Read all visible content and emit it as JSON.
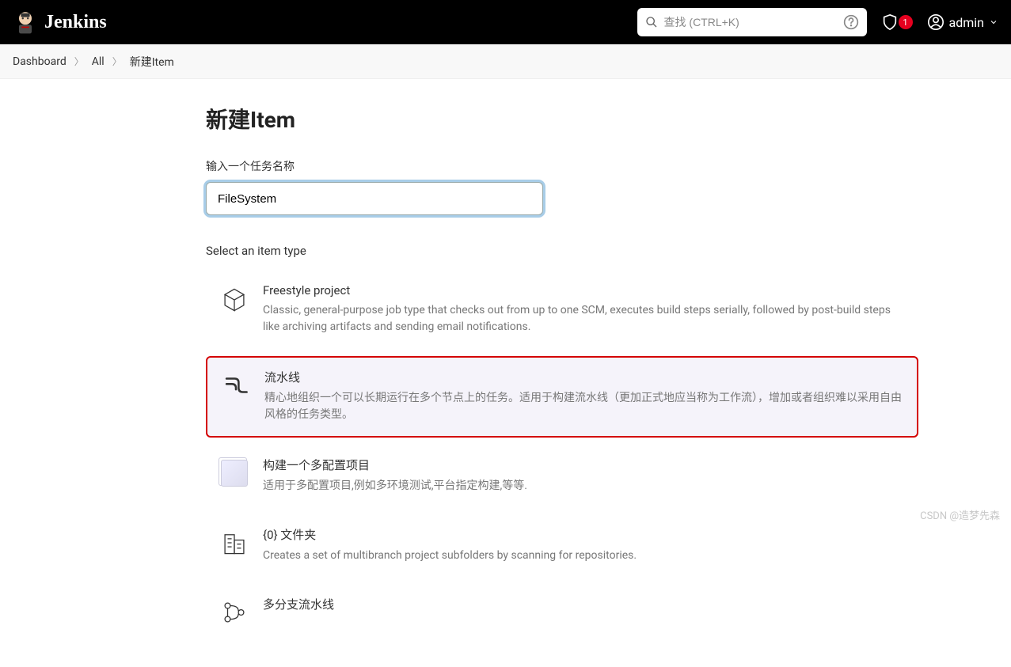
{
  "header": {
    "logo_text": "Jenkins",
    "search_placeholder": "查找 (CTRL+K)",
    "alert_count": "1",
    "user_name": "admin"
  },
  "breadcrumb": {
    "items": [
      "Dashboard",
      "All",
      "新建Item"
    ]
  },
  "page": {
    "title": "新建Item",
    "name_label": "输入一个任务名称",
    "name_value": "FileSystem",
    "select_label": "Select an item type"
  },
  "items": [
    {
      "title": "Freestyle project",
      "desc": "Classic, general-purpose job type that checks out from up to one SCM, executes build steps serially, followed by post-build steps like archiving artifacts and sending email notifications."
    },
    {
      "title": "流水线",
      "desc": "精心地组织一个可以长期运行在多个节点上的任务。适用于构建流水线（更加正式地应当称为工作流），增加或者组织难以采用自由风格的任务类型。"
    },
    {
      "title": "构建一个多配置项目",
      "desc": "适用于多配置项目,例如多环境测试,平台指定构建,等等."
    },
    {
      "title": "{0} 文件夹",
      "desc": "Creates a set of multibranch project subfolders by scanning for repositories."
    },
    {
      "title": "多分支流水线",
      "desc": ""
    }
  ],
  "watermark": "CSDN @造梦先森"
}
